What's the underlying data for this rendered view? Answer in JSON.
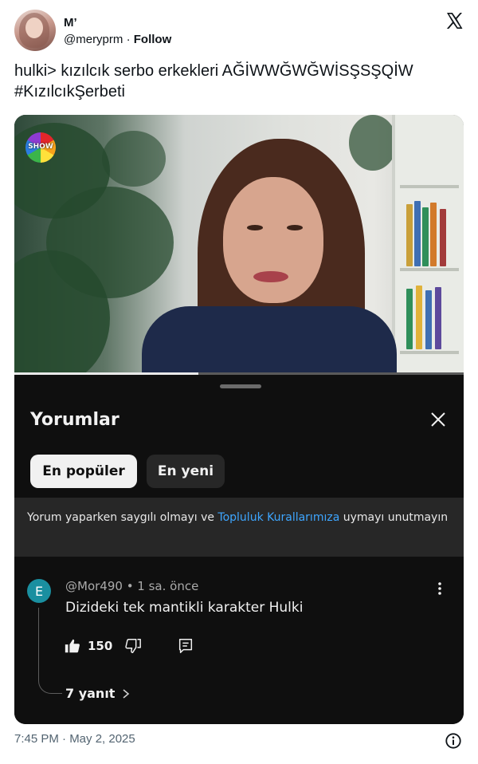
{
  "tweet": {
    "display_name": "M’",
    "handle": "@meryprm",
    "separator": "·",
    "follow_label": "Follow",
    "text_line1": "hulki> kızılcık serbo erkekleri AĞİWWĞWĞWİSŞSŞQİW",
    "text_line2": "#KızılcıkŞerbeti",
    "timestamp": "7:45 PM · May 2, 2025"
  },
  "video": {
    "channel_logo": "SHOW",
    "progress": 0.41
  },
  "comments_sheet": {
    "title": "Yorumlar",
    "chips": [
      {
        "label": "En popüler",
        "selected": true
      },
      {
        "label": "En yeni",
        "selected": false
      }
    ],
    "notice_prefix": "Yorum yaparken saygılı olmayı ve ",
    "notice_link": "Topluluk Kurallarımıza",
    "notice_suffix": " uymayı unutmayın",
    "comment": {
      "avatar_letter": "E",
      "author": "@Mor490",
      "age": " • 1 sa. önce",
      "text": "Dizideki tek mantikli karakter Hulki",
      "likes": "150",
      "replies_label": "7 yanıt"
    }
  },
  "icons": [
    "x-logo-icon",
    "close-icon",
    "more-vertical-icon",
    "thumbs-up-icon",
    "thumbs-down-icon",
    "reply-icon",
    "chevron-right-icon",
    "info-icon"
  ],
  "colors": {
    "link_blue": "#3ea6ff",
    "sheet_bg": "#0f0f0f",
    "comment_avatar": "#1a8fa0"
  }
}
